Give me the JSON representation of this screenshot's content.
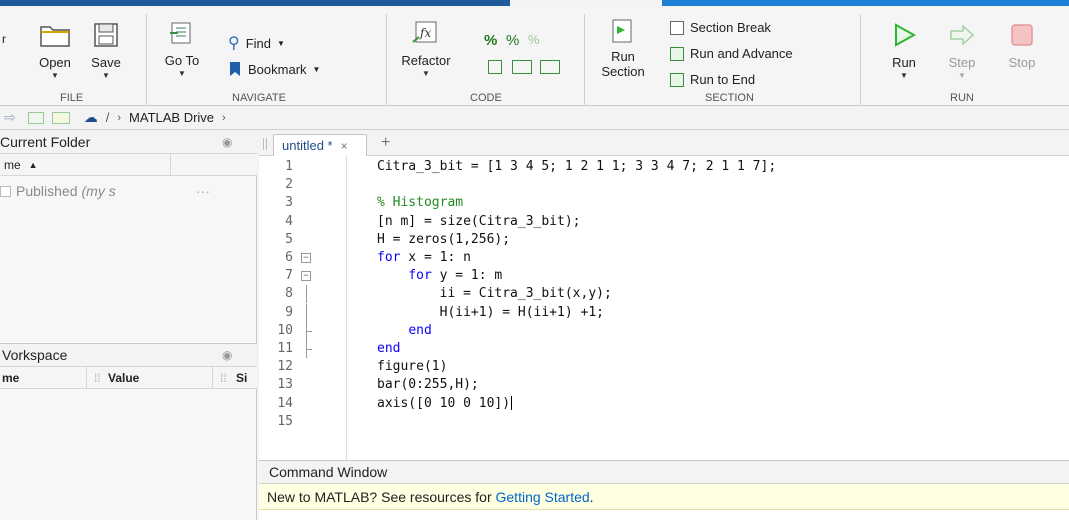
{
  "ribbon": {
    "file": {
      "section_label": "FILE",
      "open_label": "Open",
      "save_label": "Save"
    },
    "navigate": {
      "section_label": "NAVIGATE",
      "goto_label": "Go To",
      "find_label": "Find",
      "bookmark_label": "Bookmark"
    },
    "code": {
      "section_label": "CODE",
      "refactor_label": "Refactor"
    },
    "section": {
      "section_label": "SECTION",
      "run_section_line1": "Run",
      "run_section_line2": "Section",
      "section_break_label": "Section Break",
      "run_and_advance_label": "Run and Advance",
      "run_to_end_label": "Run to End"
    },
    "run": {
      "section_label": "RUN",
      "run_label": "Run",
      "step_label": "Step",
      "stop_label": "Stop"
    }
  },
  "address": {
    "root": "/",
    "folder": "MATLAB Drive"
  },
  "current_folder": {
    "title": "Current Folder",
    "name_header": "me",
    "items": [
      {
        "name": "Published",
        "note": "(my s",
        "more": "···"
      }
    ]
  },
  "workspace": {
    "title": "Vorkspace",
    "col_name": "me",
    "col_value": "Value",
    "col_size": "Si"
  },
  "editor": {
    "tab_label": "untitled *",
    "lines": [
      {
        "num": "1",
        "segments": [
          {
            "t": "Citra_3_bit = [1 3 4 5; 1 2 1 1; 3 3 4 7; 2 1 1 7];",
            "c": ""
          }
        ]
      },
      {
        "num": "2",
        "segments": []
      },
      {
        "num": "3",
        "segments": [
          {
            "t": "% Histogram",
            "c": "cm"
          }
        ]
      },
      {
        "num": "4",
        "segments": [
          {
            "t": "[n m] = size(Citra_3_bit);",
            "c": ""
          }
        ]
      },
      {
        "num": "5",
        "segments": [
          {
            "t": "H = zeros(1,256);",
            "c": ""
          }
        ]
      },
      {
        "num": "6",
        "segments": [
          {
            "t": "for",
            "c": "kw"
          },
          {
            "t": " x = 1: n",
            "c": ""
          }
        ]
      },
      {
        "num": "7",
        "segments": [
          {
            "t": "    ",
            "c": ""
          },
          {
            "t": "for",
            "c": "kw"
          },
          {
            "t": " y = 1: m",
            "c": ""
          }
        ]
      },
      {
        "num": "8",
        "segments": [
          {
            "t": "        ii = Citra_3_bit(x,y);",
            "c": ""
          }
        ]
      },
      {
        "num": "9",
        "segments": [
          {
            "t": "        H(ii+1) = H(ii+1) +1;",
            "c": ""
          }
        ]
      },
      {
        "num": "10",
        "segments": [
          {
            "t": "    ",
            "c": ""
          },
          {
            "t": "end",
            "c": "kw"
          }
        ]
      },
      {
        "num": "11",
        "segments": [
          {
            "t": "end",
            "c": "kw"
          }
        ]
      },
      {
        "num": "12",
        "segments": [
          {
            "t": "figure(1)",
            "c": ""
          }
        ]
      },
      {
        "num": "13",
        "segments": [
          {
            "t": "bar(0:255,H);",
            "c": ""
          }
        ]
      },
      {
        "num": "14",
        "segments": [
          {
            "t": "axis([0 10 0 10])",
            "c": ""
          }
        ]
      },
      {
        "num": "15",
        "segments": []
      }
    ]
  },
  "command_window": {
    "title": "Command Window",
    "message_prefix": "New to MATLAB? See resources for ",
    "message_link": "Getting Started",
    "message_suffix": "."
  },
  "colors": {
    "keyword": "#0e00ff",
    "comment": "#228b22",
    "link": "#0066cc",
    "run_green": "#2fb52f",
    "stop_red": "#f4a6a6"
  }
}
